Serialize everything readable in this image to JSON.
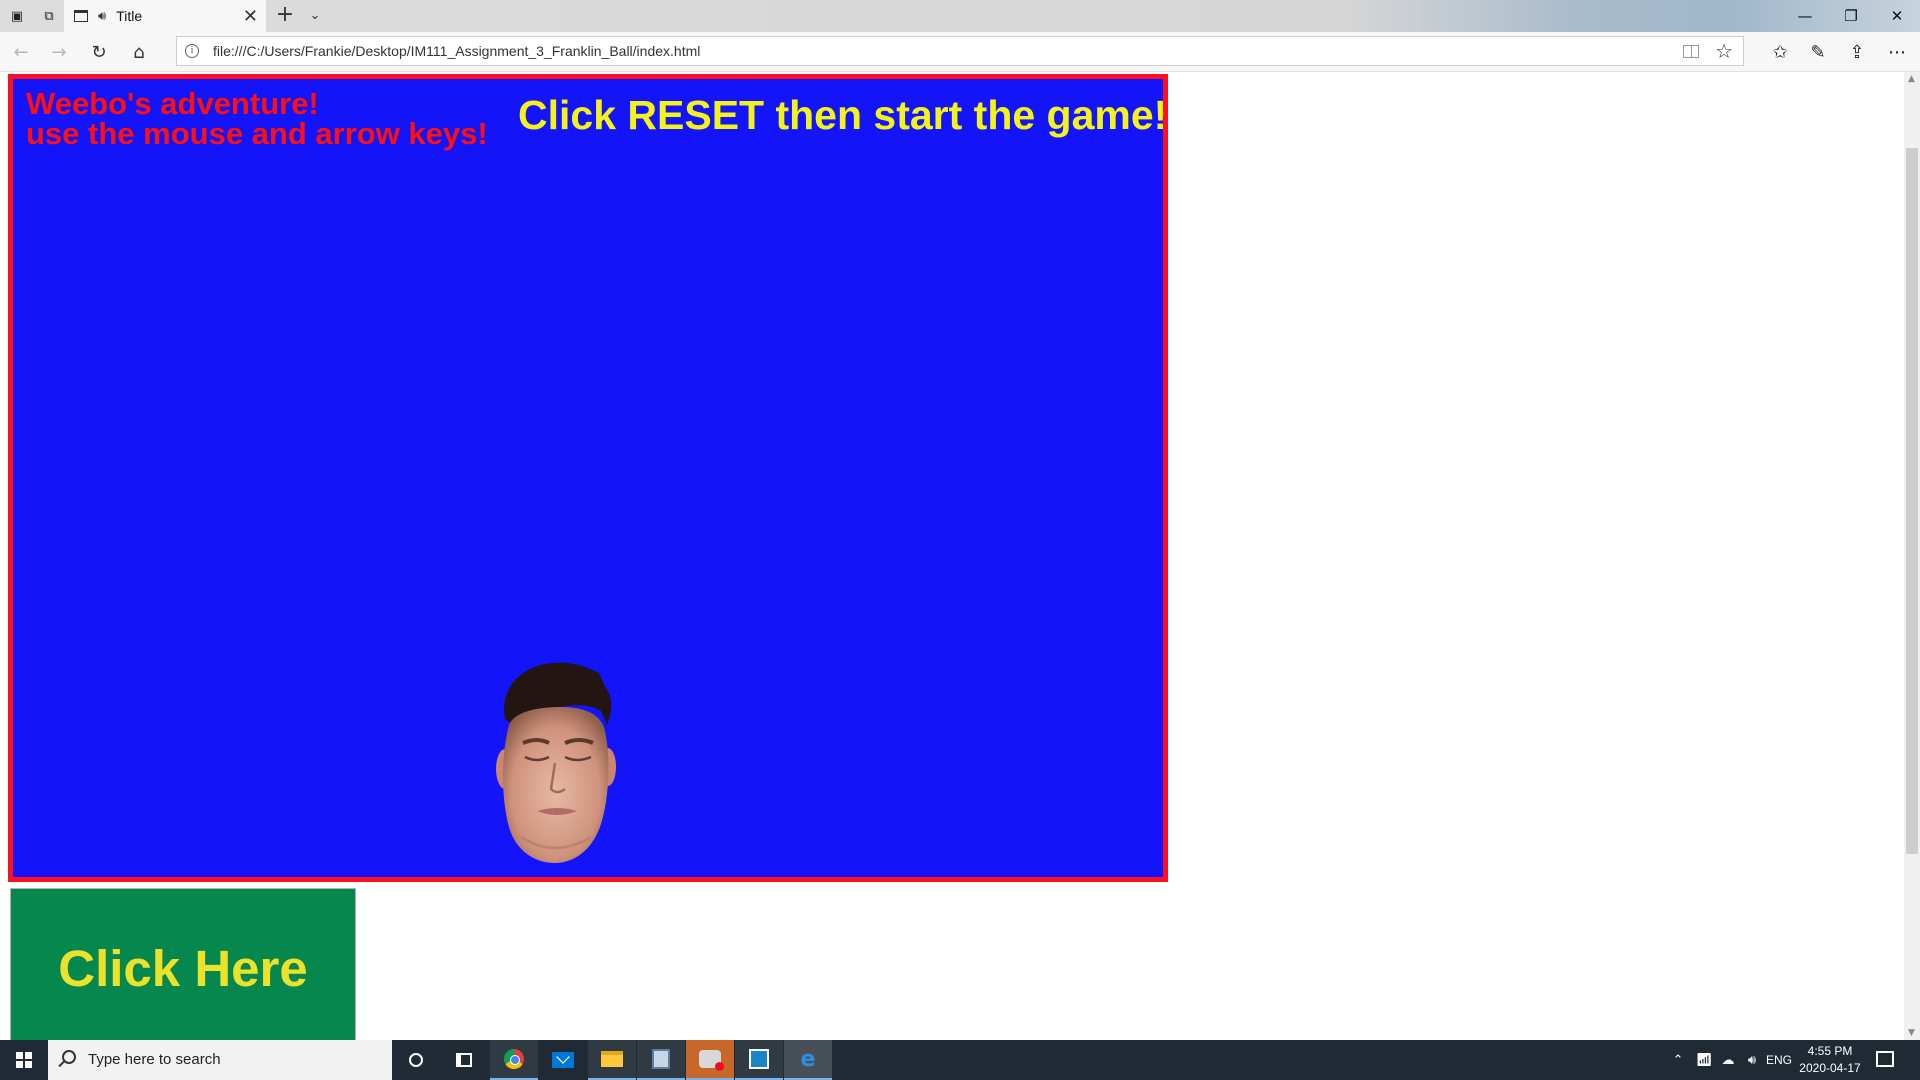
{
  "browser": {
    "tab_title": "Title",
    "tab_close_glyph": "✕",
    "new_tab_glyph": "+",
    "url": "file:///C:/Users/Frankie/Desktop/IM111_Assignment_3_Franklin_Ball/index.html"
  },
  "game": {
    "instructions_line1": "Weebo's adventure!",
    "instructions_line2": "use the mouse and arrow keys!",
    "reset_hint": "Click RESET then start the game!",
    "click_here_label": "Click Here",
    "colors": {
      "stage_background": "#1414fa",
      "stage_border": "#ff0f23",
      "instructions_text": "#ff1010",
      "reset_hint_text": "#f3f31a",
      "button_background": "#05874e",
      "button_text": "#ece22b"
    }
  },
  "taskbar": {
    "search_placeholder": "Type here to search",
    "language": "ENG",
    "time": "4:55 PM",
    "date": "2020-04-17",
    "apps": [
      "cortana-icon",
      "task-view-icon",
      "chrome-icon",
      "mail-icon",
      "file-explorer-icon",
      "photos-icon",
      "game-app-icon",
      "code-app-icon",
      "edge-icon"
    ]
  }
}
